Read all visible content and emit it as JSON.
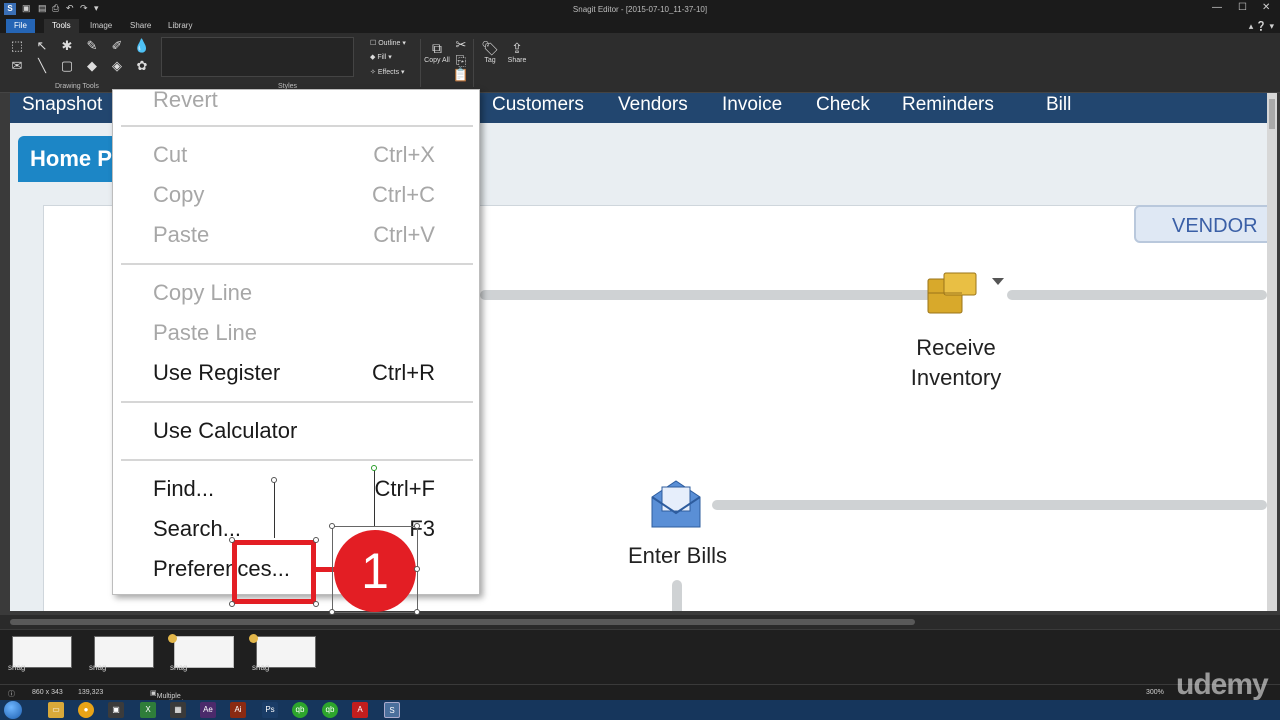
{
  "window": {
    "title": "Snagit Editor - [2015-07-10_11-37-10]"
  },
  "ribbon_tabs": [
    "File",
    "Tools",
    "Image",
    "Share",
    "Library"
  ],
  "ribbon": {
    "drawing_tools_label": "Drawing Tools",
    "styles_label": "Styles",
    "outline": "Outline",
    "fill": "Fill",
    "effects": "Effects",
    "copy_all": "Copy All",
    "tag": "Tag",
    "share": "Share"
  },
  "snapshot": {
    "nav_items": [
      "Snapshot",
      "Customers",
      "Vendors",
      "Invoice",
      "Check",
      "Reminders",
      "Bill"
    ],
    "home_label": "Home P",
    "vendor_tab": "VENDOR",
    "receive_inventory": [
      "Receive",
      "Inventory"
    ],
    "enter_bills": "Enter Bills"
  },
  "context_menu": {
    "revert": "Revert",
    "cut": {
      "label": "Cut",
      "shortcut": "Ctrl+X"
    },
    "copy": {
      "label": "Copy",
      "shortcut": "Ctrl+C"
    },
    "paste": {
      "label": "Paste",
      "shortcut": "Ctrl+V"
    },
    "copy_line": "Copy Line",
    "paste_line": "Paste Line",
    "use_register": {
      "label": "Use Register",
      "shortcut": "Ctrl+R"
    },
    "use_calculator": "Use Calculator",
    "find": {
      "label": "Find...",
      "shortcut": "Ctrl+F"
    },
    "search": {
      "label": "Search...",
      "shortcut": "F3"
    },
    "preferences": "Preferences..."
  },
  "annotation": {
    "step_number": "1"
  },
  "tray": {
    "thumb_label": "snag"
  },
  "status": {
    "dimensions": "860 x 343",
    "cursor": "139,323",
    "source": "Multiple Applications",
    "zoom": "300%"
  },
  "watermark": "udemy"
}
